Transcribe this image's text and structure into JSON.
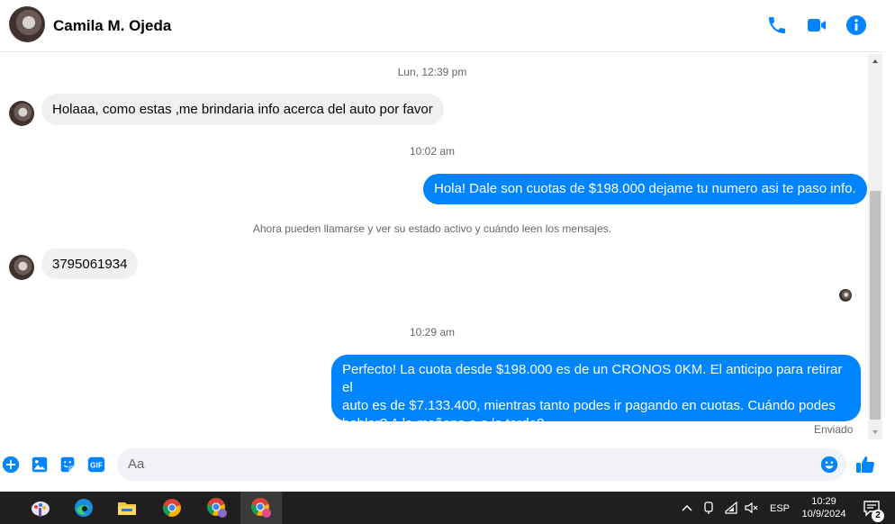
{
  "header": {
    "contact_name": "Camila M. Ojeda",
    "icons": [
      "phone-icon",
      "video-camera-icon",
      "info-icon"
    ]
  },
  "conversation": {
    "timestamp_1": "Lun, 12:39 pm",
    "msg_in_1": "Holaaa, como estas ,me brindaria info acerca del auto por favor",
    "timestamp_2": "10:02 am",
    "msg_out_1": "Hola! Dale son cuotas de $198.000 dejame tu numero asi te paso info.",
    "notice": "Ahora pueden llamarse y ver su estado activo y cuándo leen los mensajes.",
    "msg_in_2": "3795061934",
    "timestamp_3": "10:29 am",
    "msg_out_2_line1": "Perfecto! La cuota desde $198.000 es de un CRONOS 0KM. El anticipo para retirar el",
    "msg_out_2_line2": "auto es de $7.133.400, mientras tanto podes ir pagando en cuotas. Cuándo podes",
    "msg_out_2_line3": "hablar? A la mañana o a la tarde?",
    "status": "Enviado"
  },
  "composer": {
    "placeholder": "Aa",
    "icons": [
      "plus-icon",
      "image-icon",
      "sticker-icon",
      "gif-icon",
      "emoji-icon",
      "like-icon"
    ],
    "gif_label": "GIF"
  },
  "taskbar": {
    "apps": [
      "paint-icon",
      "edge-icon",
      "file-explorer-icon",
      "chrome-icon",
      "chrome-profile-icon",
      "chrome-profile-active-icon"
    ],
    "language": "ESP",
    "time": "10:29",
    "date": "10/9/2024",
    "notification_count": "2"
  },
  "colors": {
    "accent": "#0084ff",
    "incoming_bubble": "#f0f0f0",
    "taskbar": "#1f1f1f"
  }
}
